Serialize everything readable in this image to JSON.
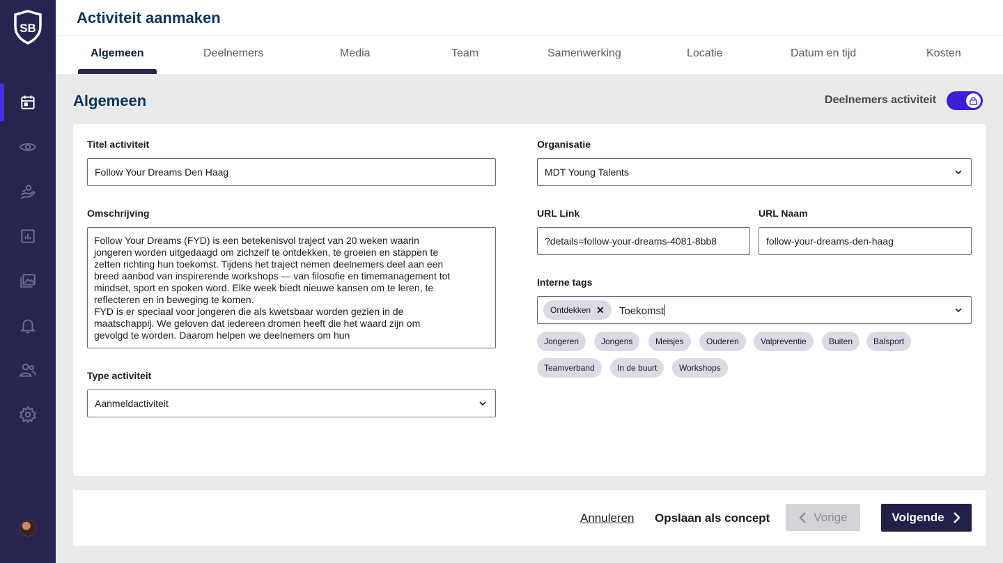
{
  "app": {
    "logo_text": "SB"
  },
  "header": {
    "title": "Activiteit aanmaken",
    "tabs": [
      {
        "label": "Algemeen",
        "active": true
      },
      {
        "label": "Deelnemers",
        "active": false
      },
      {
        "label": "Media",
        "active": false
      },
      {
        "label": "Team",
        "active": false
      },
      {
        "label": "Samenwerking",
        "active": false
      },
      {
        "label": "Locatie",
        "active": false
      },
      {
        "label": "Datum en tijd",
        "active": false
      },
      {
        "label": "Kosten",
        "active": false
      }
    ]
  },
  "sidebar": {
    "items": [
      {
        "icon": "calendar-icon",
        "active": true
      },
      {
        "icon": "eye-icon",
        "active": false
      },
      {
        "icon": "hand-money-icon",
        "active": false
      },
      {
        "icon": "chart-icon",
        "active": false
      },
      {
        "icon": "gallery-icon",
        "active": false
      },
      {
        "icon": "bell-icon",
        "active": false
      },
      {
        "icon": "users-icon",
        "active": false
      },
      {
        "icon": "gear-icon",
        "active": false
      }
    ]
  },
  "section": {
    "title": "Algemeen",
    "toggle_label": "Deelnemers activiteit",
    "toggle_on": true
  },
  "form": {
    "title_label": "Titel activiteit",
    "title_value": "Follow Your Dreams Den Haag",
    "description_label": "Omschrijving",
    "description_value": "Follow Your Dreams (FYD) is een betekenisvol traject van 20 weken waarin\njongeren worden uitgedaagd om zichzelf te ontdekken, te groeien en stappen te\nzetten richting hun toekomst. Tijdens het traject nemen deelnemers deel aan een\nbreed aanbod van inspirerende workshops — van filosofie en timemanagement tot\nmindset, sport en spoken word. Elke week biedt nieuwe kansen om te leren, te\nreflecteren en in beweging te komen.\nFYD is er speciaal voor jongeren die als kwetsbaar worden gezien in de\nmaatschappij. We geloven dat iedereen dromen heeft die het waard zijn om\ngevolgd te worden. Daarom helpen we deelnemers om hun",
    "type_label": "Type activiteit",
    "type_value": "Aanmeldactiviteit",
    "organisation_label": "Organisatie",
    "organisation_value": "MDT Young Talents",
    "url_link_label": "URL Link",
    "url_link_value": "?details=follow-your-dreams-4081-8bb8",
    "url_name_label": "URL Naam",
    "url_name_value": "follow-your-dreams-den-haag",
    "tags_label": "Interne tags",
    "selected_tag": "Ontdekken",
    "tag_input_value": "Toekomst",
    "tag_suggestions": [
      "Jongeren",
      "Jongens",
      "Meisjes",
      "Ouderen",
      "Valpreventie",
      "Buiten",
      "Balsport",
      "Teamverband",
      "In de buurt",
      "Workshops"
    ]
  },
  "footer": {
    "cancel_label": "Annuleren",
    "draft_label": "Opslaan als concept",
    "prev_label": "Vorige",
    "next_label": "Volgende"
  },
  "colors": {
    "sidebar_bg": "#282452",
    "accent": "#3c1fd9",
    "title": "#0c3559",
    "primary_button": "#23204a"
  }
}
